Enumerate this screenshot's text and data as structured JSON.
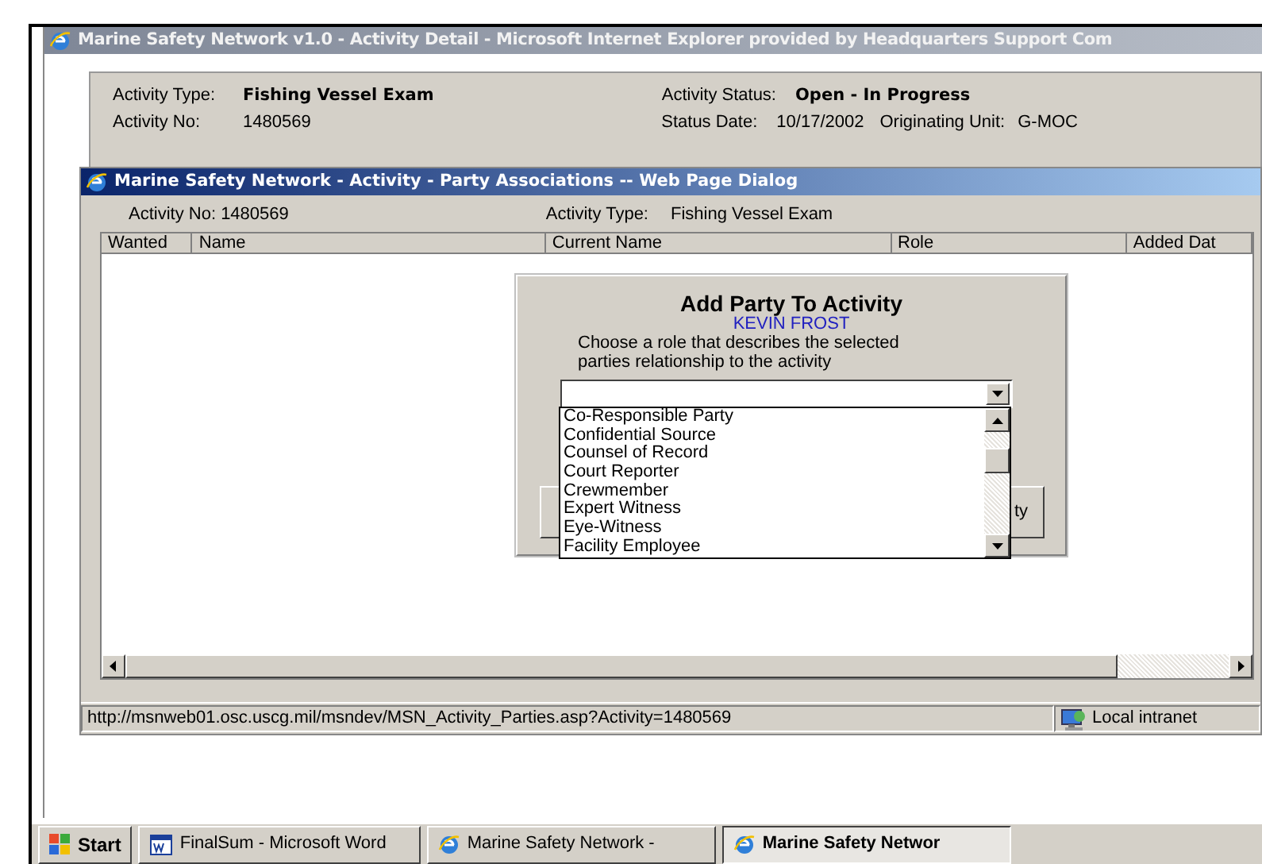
{
  "ie_window": {
    "title": "Marine Safety Network v1.0 - Activity Detail - Microsoft Internet Explorer provided by Headquarters Support Com",
    "left_fields": [
      {
        "label": "Activity Type:",
        "value": "Fishing Vessel Exam",
        "bold": true
      },
      {
        "label": "Activity No:",
        "value": "1480569",
        "bold": false
      }
    ],
    "right_fields": [
      {
        "label": "Activity Status:",
        "value": "Open - In Progress",
        "bold": true
      },
      {
        "label": "Status Date:",
        "value": "10/17/2002",
        "bold": false,
        "extra_label": "Originating Unit:",
        "extra_value": "G-MOC"
      }
    ]
  },
  "dialog": {
    "title": "Marine Safety Network - Activity - Party Associations -- Web Page Dialog",
    "activity_no": {
      "label": "Activity No:",
      "value": "1480569"
    },
    "activity_type": {
      "label": "Activity Type:",
      "value": "Fishing Vessel Exam"
    },
    "table": {
      "columns": [
        "Wanted",
        "Name",
        "Current Name",
        "Role",
        "Added Dat"
      ]
    },
    "popup": {
      "title": "Add Party To Activity",
      "party": "KEVIN FROST",
      "instructions": "Choose a role that describes the selected parties relationship to the activity",
      "button_fragment": "ty",
      "role_options": [
        {
          "label": "Co-Responsible Party",
          "selected": false
        },
        {
          "label": "Confidential Source",
          "selected": false
        },
        {
          "label": "Counsel of Record",
          "selected": false
        },
        {
          "label": "Court Reporter",
          "selected": false
        },
        {
          "label": "Crewmember",
          "selected": false
        },
        {
          "label": "Expert Witness",
          "selected": false
        },
        {
          "label": "Eye-Witness",
          "selected": false
        },
        {
          "label": "Facility Employee",
          "selected": false
        }
      ]
    },
    "status_bar": {
      "url": "http://msnweb01.osc.uscg.mil/msndev/MSN_Activity_Parties.asp?Activity=1480569",
      "zone": "Local intranet"
    }
  },
  "taskbar": {
    "start": "Start",
    "tasks": [
      {
        "label": "FinalSum - Microsoft Word",
        "kind": "word",
        "selected": false
      },
      {
        "label": "Marine Safety Network -",
        "kind": "ie",
        "selected": false
      },
      {
        "label": "Marine Safety Networ",
        "kind": "ie",
        "selected": true
      }
    ]
  }
}
